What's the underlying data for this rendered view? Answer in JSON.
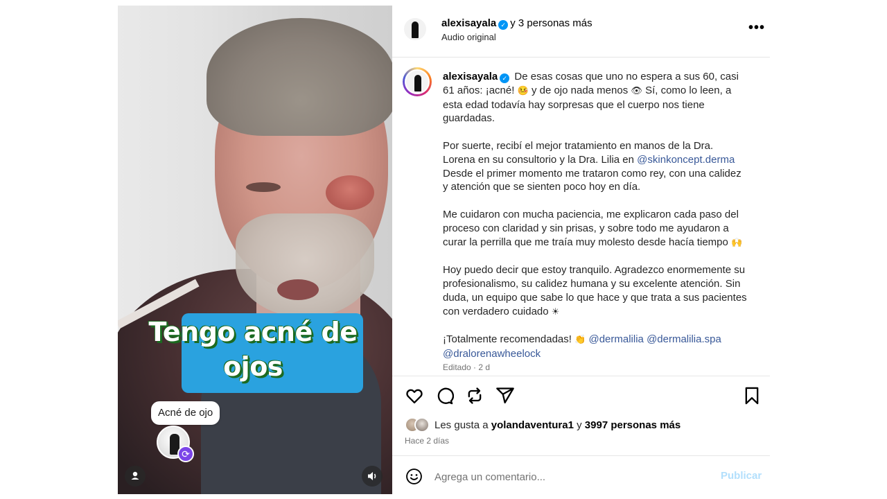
{
  "media": {
    "overlay_text": "Tengo acné de ojos",
    "tag_label": "Acné de ojo",
    "caption_box_color": "#2aa2df",
    "icons": [
      "user-tag-icon",
      "volume-icon",
      "remix-icon"
    ]
  },
  "header": {
    "username": "alexisayala",
    "coauthors": "y 3 personas más",
    "audio": "Audio original",
    "more_label": "•••"
  },
  "caption": {
    "username": "alexisayala",
    "p1a": "De esas cosas que uno no espera a sus 60, casi 61 años: ¡acné!",
    "p1b": "y de ojo nada menos",
    "p1c": "Sí, como lo leen, a esta edad todavía hay sorpresas que el cuerpo nos tiene guardadas.",
    "p2a": "Por suerte, recibí el mejor tratamiento en manos de la Dra. Lorena en su consultorio y la Dra. Lilia en",
    "p2_mention": "@skinkoncept.derma",
    "p2b": "Desde el primer momento me trataron como rey, con una calidez y atención que se sienten poco hoy en día.",
    "p3": "Me cuidaron con mucha paciencia, me explicaron cada paso del proceso con claridad y sin prisas, y sobre todo me ayudaron a curar la perrilla que me traía muy molesto desde hacía tiempo",
    "p4": "Hoy puedo decir que estoy tranquilo. Agradezco enormemente su profesionalismo, su calidez humana y su excelente atención. Sin duda, un equipo que sabe lo que hace y que trata a sus pacientes con verdadero cuidado",
    "p5a": "¡Totalmente recomendadas!",
    "mention1": "@dermalilia",
    "mention2": "@dermalilia.spa",
    "mention3": "@dralorenawheelock",
    "edited": "Editado · 2 d"
  },
  "actions": {
    "icons": [
      "heart-icon",
      "comment-icon",
      "repost-icon",
      "share-icon",
      "bookmark-icon"
    ]
  },
  "likes": {
    "prefix": "Les gusta a",
    "user": "yolandaventura1",
    "middle": "y",
    "count": "3997 personas más",
    "time": "Hace 2 días"
  },
  "comment": {
    "placeholder": "Agrega un comentario...",
    "post_label": "Publicar"
  },
  "colors": {
    "verified": "#0095f6",
    "mention": "#385898",
    "post_disabled": "#b2dffc",
    "remix_badge": "#7b45e8"
  }
}
